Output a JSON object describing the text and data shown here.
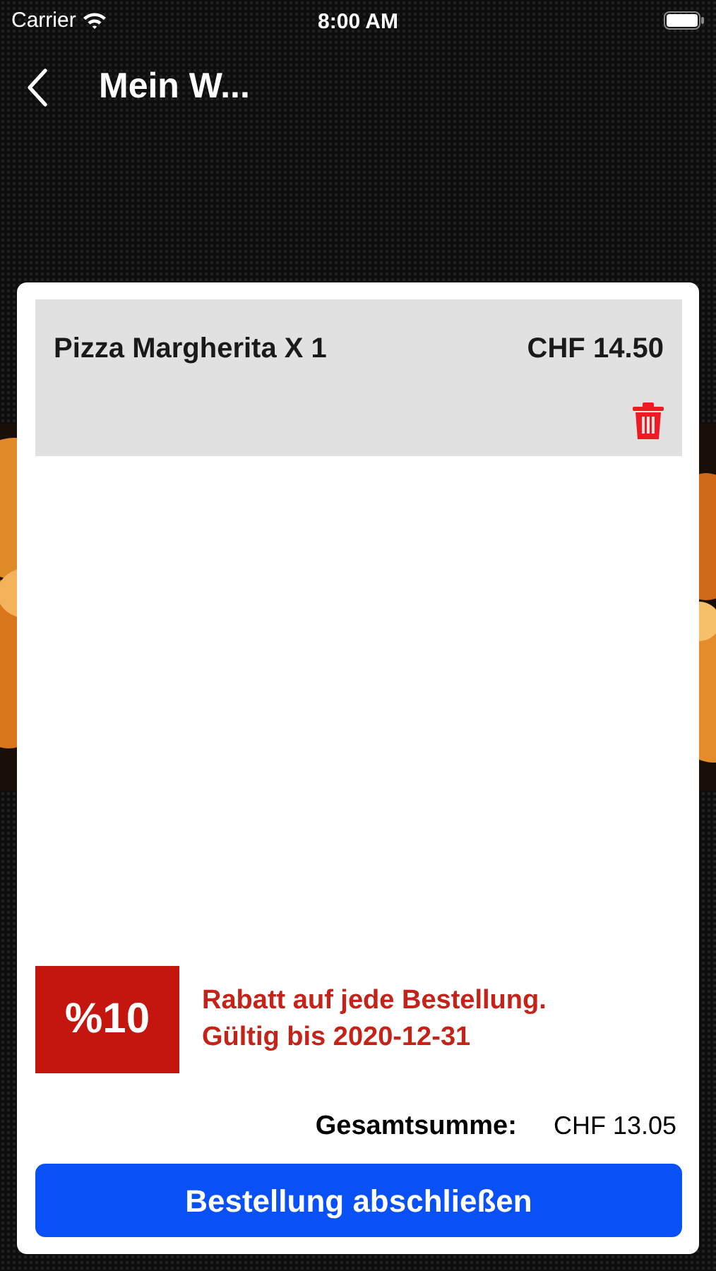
{
  "status_bar": {
    "carrier": "Carrier",
    "time": "8:00 AM"
  },
  "nav": {
    "title": "Mein W..."
  },
  "cart_items": [
    {
      "name": "Pizza Margherita X 1",
      "price": "CHF 14.50"
    }
  ],
  "discount": {
    "badge": "%10",
    "text": "Rabatt auf jede Bestellung.\nGültig bis 2020-12-31"
  },
  "total": {
    "label": "Gesamtsumme:",
    "value": "CHF 13.05"
  },
  "checkout_button": "Bestellung abschließen"
}
